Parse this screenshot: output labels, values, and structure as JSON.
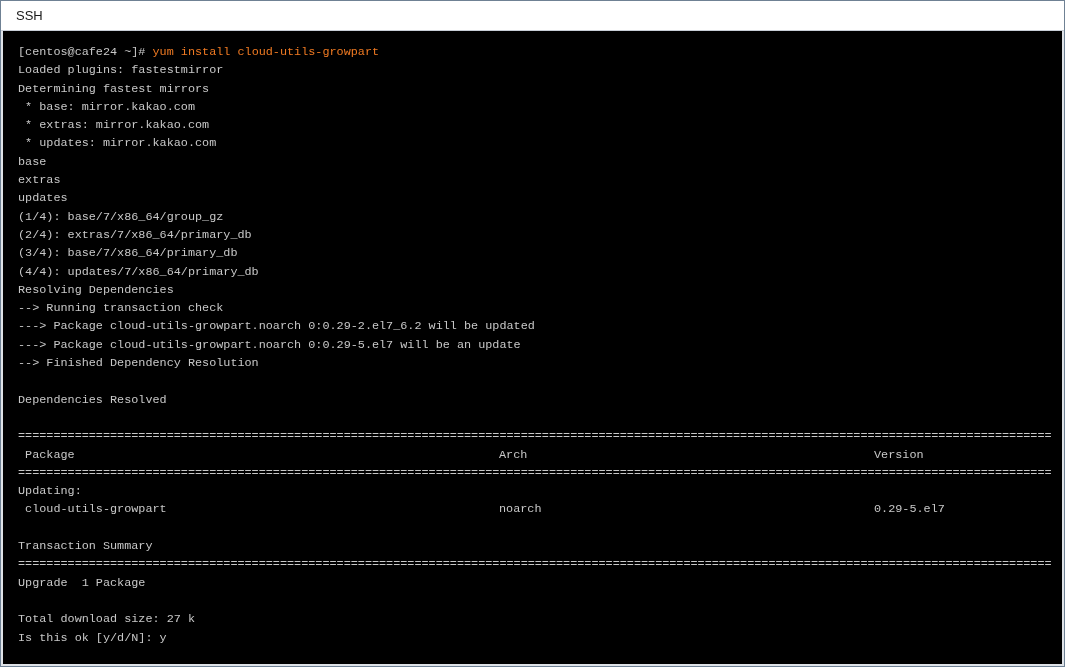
{
  "window": {
    "title": "SSH"
  },
  "terminal": {
    "lines": [
      {
        "kind": "prompt",
        "prompt": "[centos@cafe24 ~]# ",
        "command": "yum install cloud-utils-growpart"
      },
      {
        "kind": "text",
        "text": "Loaded plugins: fastestmirror"
      },
      {
        "kind": "text",
        "text": "Determining fastest mirrors"
      },
      {
        "kind": "text",
        "text": " * base: mirror.kakao.com"
      },
      {
        "kind": "text",
        "text": " * extras: mirror.kakao.com"
      },
      {
        "kind": "text",
        "text": " * updates: mirror.kakao.com"
      },
      {
        "kind": "text",
        "text": "base"
      },
      {
        "kind": "text",
        "text": "extras"
      },
      {
        "kind": "text",
        "text": "updates"
      },
      {
        "kind": "text",
        "text": "(1/4): base/7/x86_64/group_gz"
      },
      {
        "kind": "text",
        "text": "(2/4): extras/7/x86_64/primary_db"
      },
      {
        "kind": "text",
        "text": "(3/4): base/7/x86_64/primary_db"
      },
      {
        "kind": "text",
        "text": "(4/4): updates/7/x86_64/primary_db"
      },
      {
        "kind": "text",
        "text": "Resolving Dependencies"
      },
      {
        "kind": "text",
        "text": "--> Running transaction check"
      },
      {
        "kind": "text",
        "text": "---> Package cloud-utils-growpart.noarch 0:0.29-2.el7_6.2 will be updated"
      },
      {
        "kind": "text",
        "text": "---> Package cloud-utils-growpart.noarch 0:0.29-5.el7 will be an update"
      },
      {
        "kind": "text",
        "text": "--> Finished Dependency Resolution"
      },
      {
        "kind": "blank"
      },
      {
        "kind": "text",
        "text": "Dependencies Resolved"
      },
      {
        "kind": "blank"
      },
      {
        "kind": "rule",
        "text": "=================================================================================================================================================="
      },
      {
        "kind": "columns",
        "cells": [
          " Package",
          "Arch",
          "Version"
        ]
      },
      {
        "kind": "rule",
        "text": "=================================================================================================================================================="
      },
      {
        "kind": "text",
        "text": "Updating:"
      },
      {
        "kind": "columns",
        "cells": [
          " cloud-utils-growpart",
          "noarch",
          "0.29-5.el7"
        ]
      },
      {
        "kind": "blank"
      },
      {
        "kind": "text",
        "text": "Transaction Summary"
      },
      {
        "kind": "rule",
        "text": "=================================================================================================================================================="
      },
      {
        "kind": "text",
        "text": "Upgrade  1 Package"
      },
      {
        "kind": "blank"
      },
      {
        "kind": "text",
        "text": "Total download size: 27 k"
      },
      {
        "kind": "text",
        "text": "Is this ok [y/d/N]: y"
      }
    ]
  }
}
